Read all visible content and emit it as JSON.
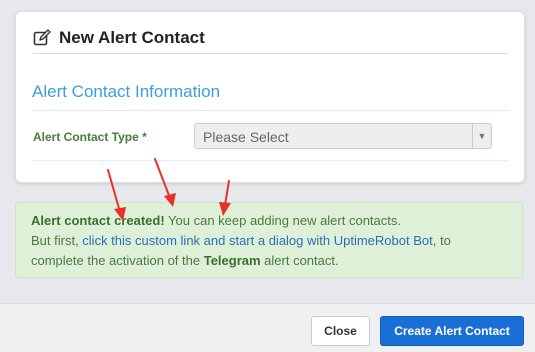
{
  "colors": {
    "accent_blue": "#3d9de0",
    "primary_button": "#1a6fd6",
    "success_bg": "#dff0d8",
    "success_text": "#4a7a3e",
    "annotation_red": "#e8312a"
  },
  "modal": {
    "title": "New Alert Contact",
    "title_icon": "edit-icon"
  },
  "section": {
    "title": "Alert Contact Information"
  },
  "form": {
    "type_label": "Alert Contact Type *",
    "type_select_value": "Please Select"
  },
  "alert": {
    "bold_intro": "Alert contact created!",
    "text_1": " You can keep adding new alert contacts.",
    "text_2": "But first, ",
    "link_text": "click this custom link and start a dialog with UptimeRobot Bot",
    "text_3": ", to complete the activation of the ",
    "telegram": "Telegram",
    "text_4": " alert contact."
  },
  "footer": {
    "close_label": "Close",
    "create_label": "Create Alert Contact"
  }
}
